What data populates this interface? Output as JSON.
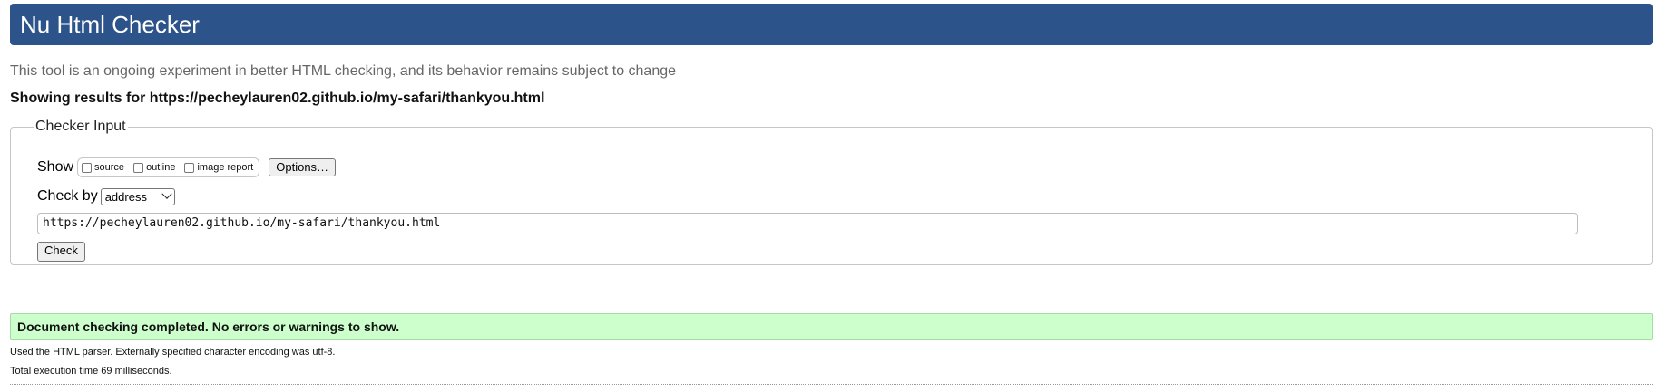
{
  "header": {
    "title": "Nu Html Checker",
    "background_color": "#2d548a"
  },
  "subtitle": "This tool is an ongoing experiment in better HTML checking, and its behavior remains subject to change",
  "results": {
    "prefix": "Showing results for",
    "url": "https://pecheylauren02.github.io/my-safari/thankyou.html"
  },
  "checker_input": {
    "legend": "Checker Input",
    "show_label": "Show",
    "show_options": [
      {
        "label": "source",
        "checked": false
      },
      {
        "label": "outline",
        "checked": false
      },
      {
        "label": "image report",
        "checked": false
      }
    ],
    "options_button": "Options…",
    "check_by_label": "Check by",
    "check_by_selected": "address",
    "url_value": "https://pecheylauren02.github.io/my-safari/thankyou.html",
    "check_button": "Check"
  },
  "status": {
    "message": "Document checking completed. No errors or warnings to show.",
    "color": "#ccffcc"
  },
  "notes": {
    "parser": "Used the HTML parser. Externally specified character encoding was utf-8.",
    "execution_time": "Total execution time 69 milliseconds."
  }
}
